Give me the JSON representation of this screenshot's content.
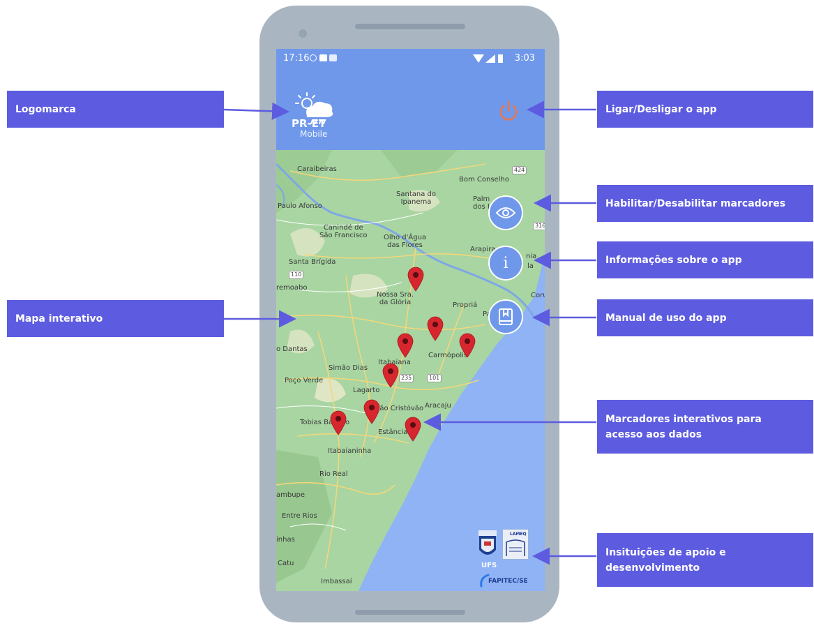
{
  "status_bar": {
    "left_time": "17:16",
    "right_time": "3:03"
  },
  "app": {
    "logo_line1": "PR-ET",
    "logo_line2": "Mobile",
    "appbar_color": "#6f98ea",
    "power_icon": "power-icon",
    "power_color": "#e8754f"
  },
  "fab_buttons": [
    {
      "icon": "eye-icon"
    },
    {
      "icon": "info-icon",
      "glyph": "i"
    },
    {
      "icon": "book-icon"
    }
  ],
  "map": {
    "labels": {
      "caraibeiras": "Caraibeiras",
      "bom_conselho": "Bom Conselho",
      "santana": "Santana do\nIpanema",
      "paulo_afonso": "Paulo Afonso",
      "palm": "Palm\ndos I",
      "caninde": "Canindé de\nSão Francisco",
      "olho": "Olho d'Água\ndas Flores",
      "arapira": "Arapira",
      "santa_brigida": "Santa Brígida",
      "remoabo": "remoabo",
      "nossa_sra": "Nossa Sra.\nda Glória",
      "propria": "Propriá",
      "coru": "Coru",
      "dantas": "o Dantas",
      "itabaiana": "Itabaiana",
      "carmopolis": "Carmópolis",
      "simao": "Simão Dias",
      "poco_verde": "Poço Verde",
      "lagarto": "Lagarto",
      "sao_cristovao": "São Cristóvão",
      "aracaju": "Aracaju",
      "tobias": "Tobias Barreto",
      "estancia": "Estância",
      "itabaianinha": "Itabaianinha",
      "rio_real": "Rio Real",
      "ambupe": "ambupe",
      "entre_rios": "Entre Rios",
      "inhas": "inhas",
      "catu": "Catu",
      "imbassai": "Imbassaí",
      "pa": "Pa",
      "nia": "nia",
      "la": "la"
    },
    "road_shields": [
      "424",
      "316",
      "110",
      "235",
      "101"
    ],
    "marker_color": "#d8262f"
  },
  "institutions": {
    "ufs": "UFS",
    "lameq": "LAMEQ",
    "fapitec": "FAPITEC/SE"
  },
  "callouts": {
    "logomarca": "Logomarca",
    "ligar": "Ligar/Desligar o app",
    "habilitar": "Habilitar/Desabilitar marcadores",
    "informacoes": "Informações sobre o app",
    "mapa": "Mapa interativo",
    "manual": "Manual de uso do app",
    "marcadores": "Marcadores interativos para\nacesso aos dados",
    "instituicoes": "Insituições de apoio e\ndesenvolvimento"
  },
  "callout_color": "#5d5ce0"
}
